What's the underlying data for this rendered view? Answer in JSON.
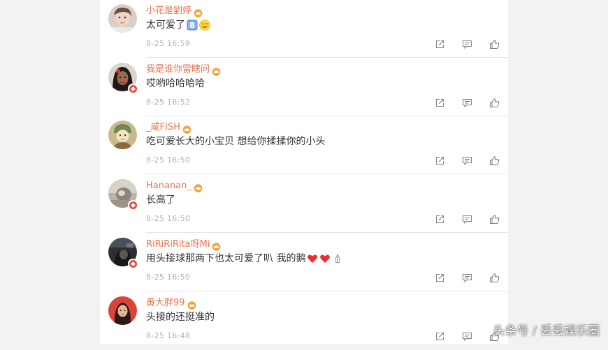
{
  "comments": [
    {
      "username": "小花是劉婷",
      "text": "太可爱了",
      "time": "8-25 16:59",
      "emojis": [
        "keycap-8-emoji",
        "smile-emoji"
      ],
      "verified": false
    },
    {
      "username": "我是谁你雷瞎问",
      "text": "哎哟哈哈哈哈",
      "time": "8-25 16:52",
      "emojis": [],
      "verified": true
    },
    {
      "username": "_咸FISH",
      "text": "吃可爱长大的小宝贝 想给你揉揉你的小头",
      "time": "8-25 16:50",
      "emojis": [],
      "verified": false
    },
    {
      "username": "Hananan_",
      "text": "长高了",
      "time": "8-25 16:50",
      "emojis": [],
      "verified": true
    },
    {
      "username": "RiRiRiRita呀Mi",
      "text": "用头接球那两下也太可爱了叭 我的鹅",
      "time": "8-25 16:50",
      "emojis": [
        "red-heart-emoji",
        "red-heart-emoji",
        "pray-emoji"
      ],
      "verified": true
    },
    {
      "username": "黄大胖99",
      "text": "头接的还挺准的",
      "time": "8-25 16:48",
      "emojis": [],
      "verified": false
    }
  ],
  "icons": {
    "badge": "crown-badge-icon",
    "repost": "repost-icon",
    "comment": "comment-icon",
    "like": "like-icon"
  },
  "colors": {
    "username": "#eb7350",
    "text": "#333333",
    "time": "#b3b3b3",
    "icon": "#808080"
  },
  "watermark": "头条号 / 丢丢娱乐圈"
}
